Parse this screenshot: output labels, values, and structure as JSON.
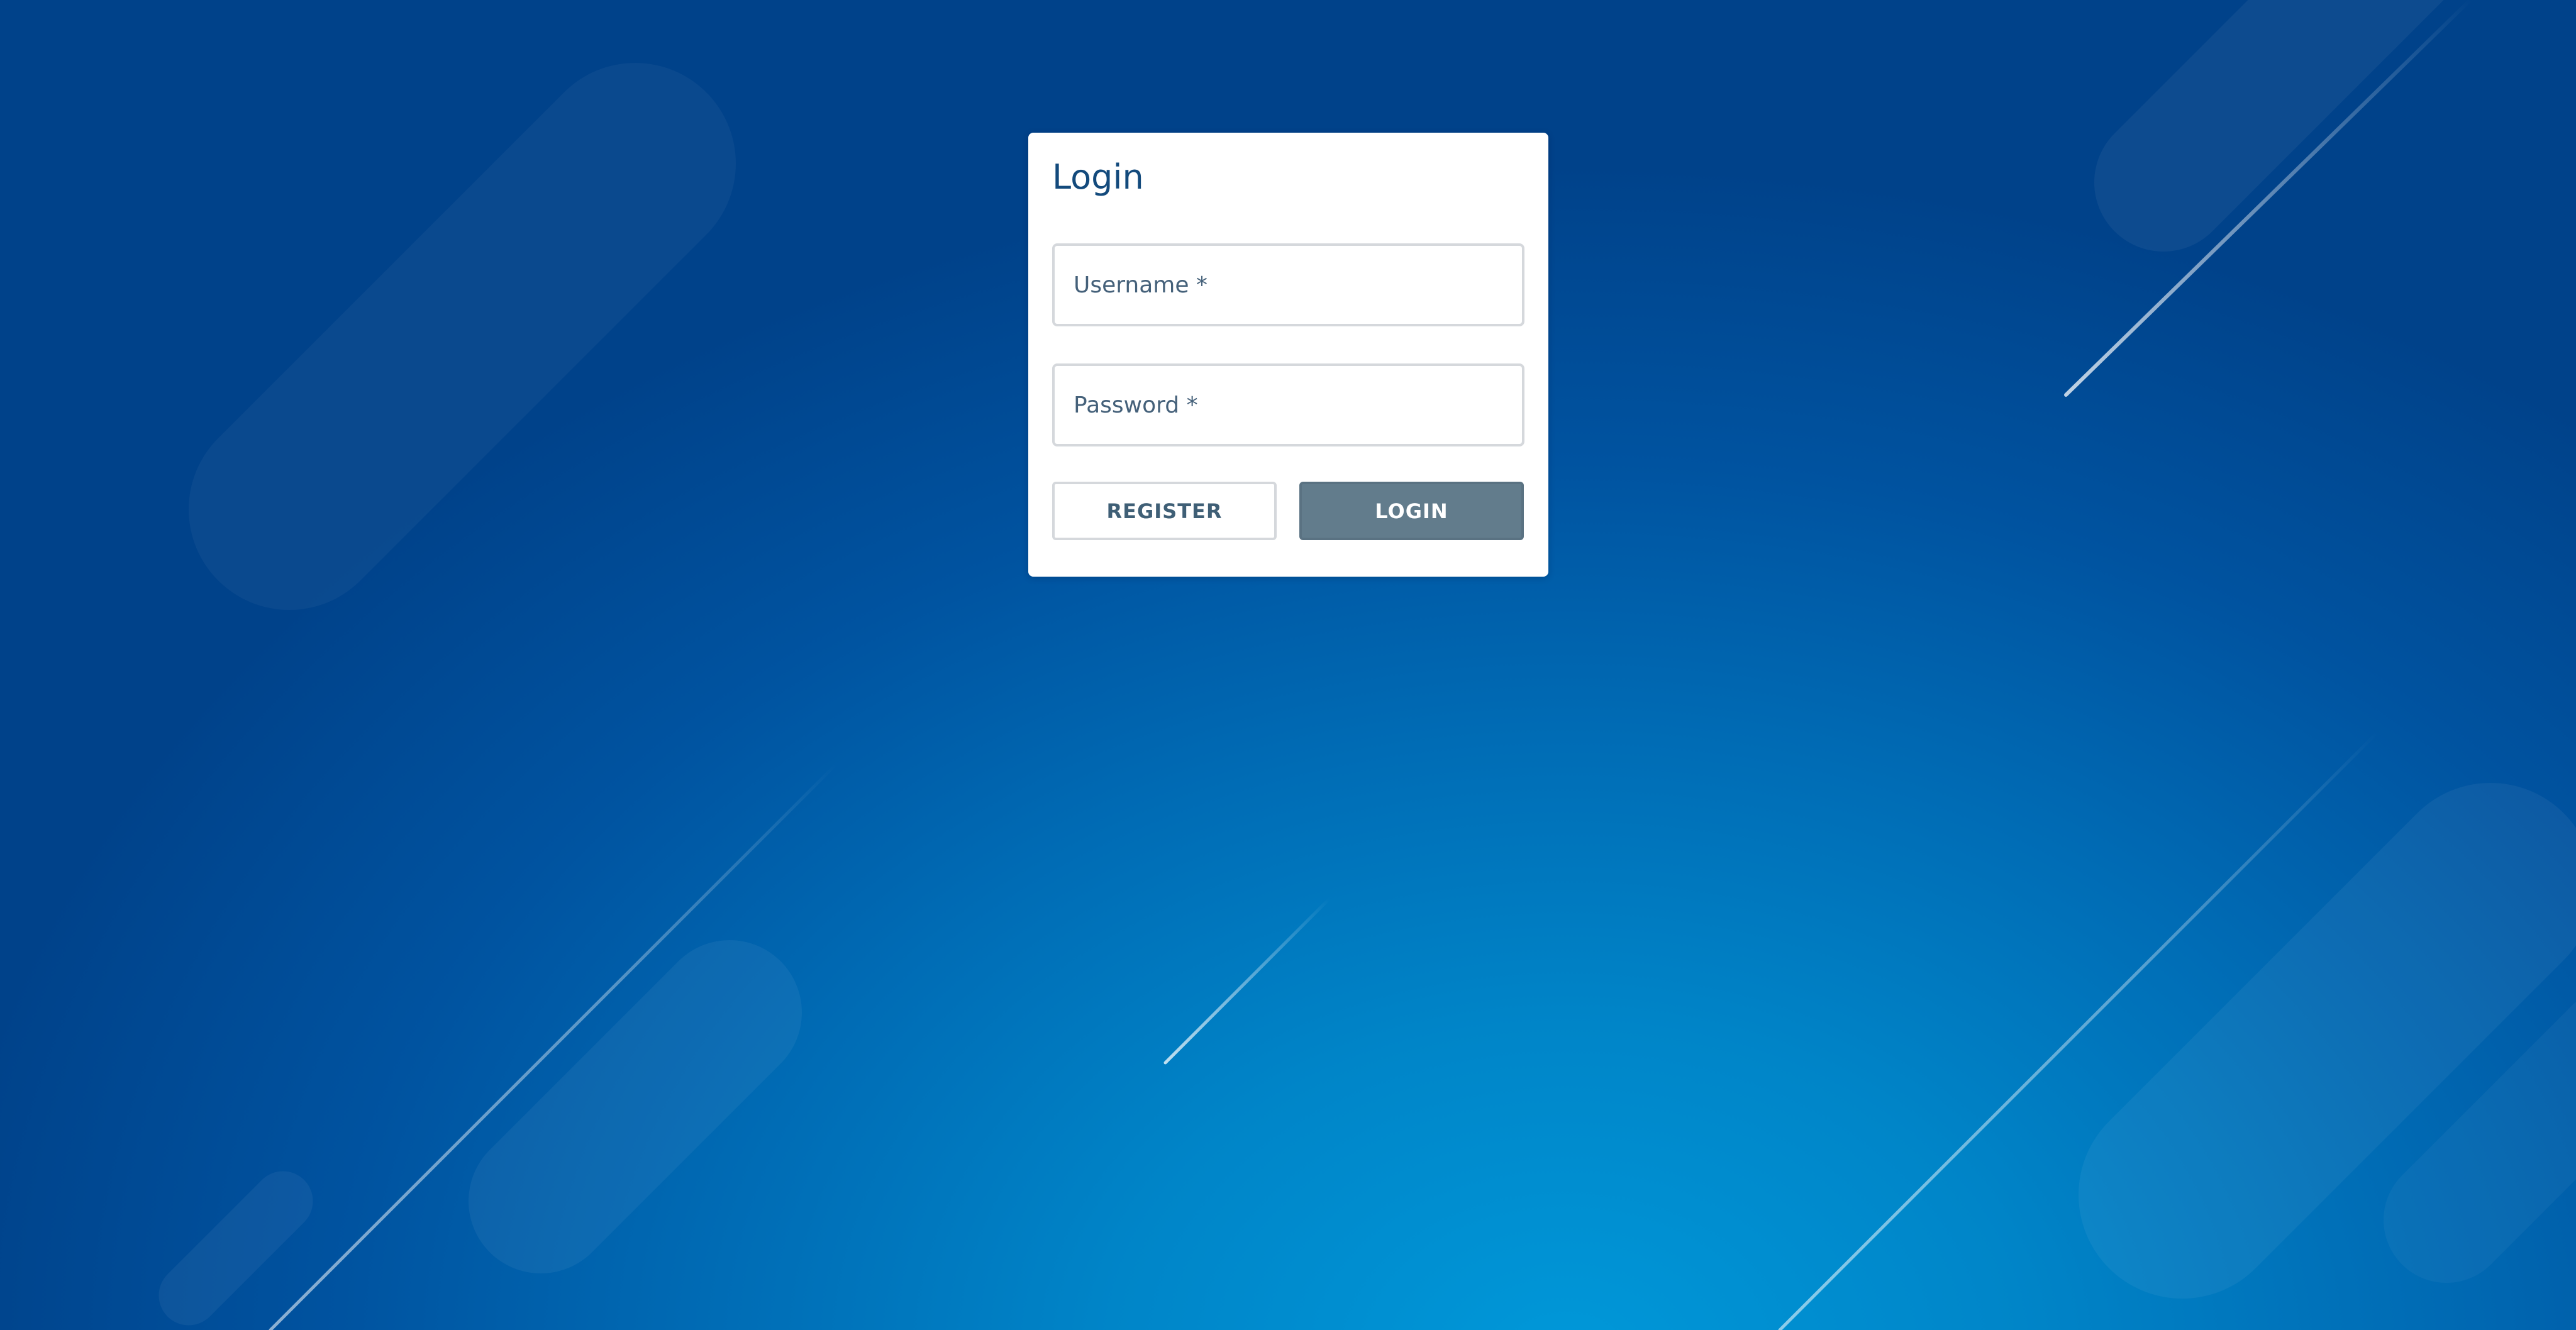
{
  "login": {
    "title": "Login",
    "username": {
      "placeholder": "Username *",
      "value": ""
    },
    "password": {
      "placeholder": "Password *",
      "value": ""
    },
    "register_label": "REGISTER",
    "login_label": "LOGIN"
  },
  "colors": {
    "background_top": "#00428a",
    "background_bottom": "#0098d9",
    "title": "#134a7c",
    "login_button": "#627c8c",
    "card": "#ffffff"
  }
}
